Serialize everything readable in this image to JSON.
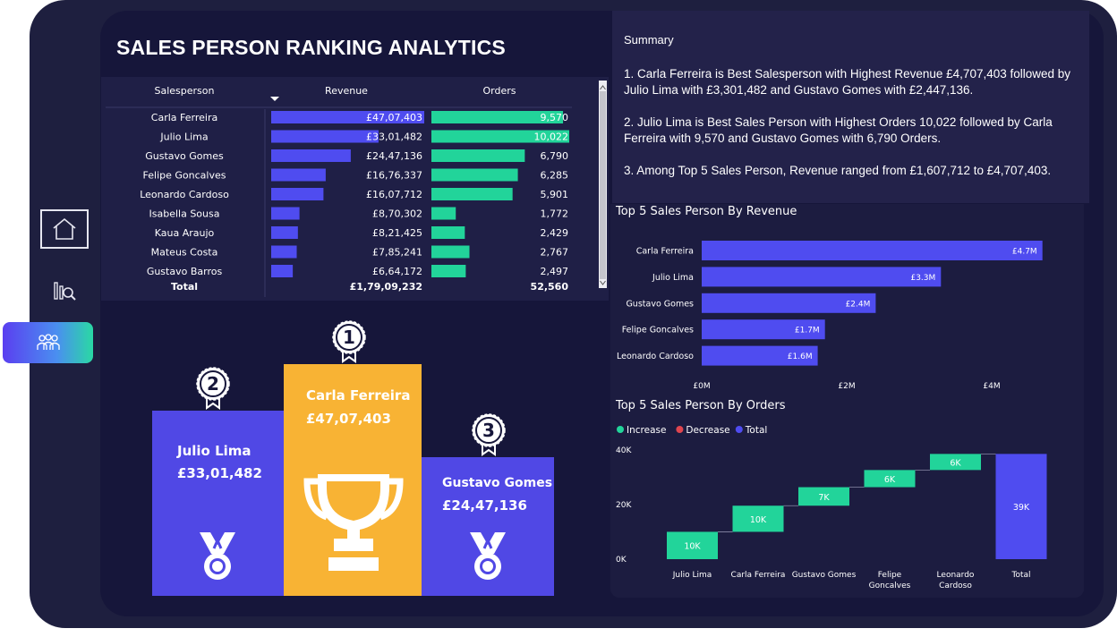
{
  "page": {
    "title": "SALES PERSON RANKING ANALYTICS"
  },
  "nav": [
    {
      "name": "home",
      "icon": "home-icon"
    },
    {
      "name": "inspect",
      "icon": "chart-search-icon"
    },
    {
      "name": "people",
      "icon": "people-icon",
      "active": true
    }
  ],
  "table": {
    "headers": [
      "Salesperson",
      "Revenue",
      "Orders"
    ],
    "sort_icon": "sort-desc-icon",
    "rows": [
      {
        "name": "Carla Ferreira",
        "revenue_label": "£47,07,403",
        "revenue": 4707403,
        "orders_label": "9,570",
        "orders": 9570
      },
      {
        "name": "Julio Lima",
        "revenue_label": "£33,01,482",
        "revenue": 3301482,
        "orders_label": "10,022",
        "orders": 10022
      },
      {
        "name": "Gustavo Gomes",
        "revenue_label": "£24,47,136",
        "revenue": 2447136,
        "orders_label": "6,790",
        "orders": 6790
      },
      {
        "name": "Felipe Goncalves",
        "revenue_label": "£16,76,337",
        "revenue": 1676337,
        "orders_label": "6,285",
        "orders": 6285
      },
      {
        "name": "Leonardo Cardoso",
        "revenue_label": "£16,07,712",
        "revenue": 1607712,
        "orders_label": "5,901",
        "orders": 5901
      },
      {
        "name": "Isabella Sousa",
        "revenue_label": "£8,70,302",
        "revenue": 870302,
        "orders_label": "1,772",
        "orders": 1772
      },
      {
        "name": "Kaua Araujo",
        "revenue_label": "£8,21,425",
        "revenue": 821425,
        "orders_label": "2,429",
        "orders": 2429
      },
      {
        "name": "Mateus Costa",
        "revenue_label": "£7,85,241",
        "revenue": 785241,
        "orders_label": "2,767",
        "orders": 2767
      },
      {
        "name": "Gustavo Barros",
        "revenue_label": "£6,64,172",
        "revenue": 664172,
        "orders_label": "2,497",
        "orders": 2497
      }
    ],
    "total": {
      "label": "Total",
      "revenue_label": "£1,79,09,232",
      "orders_label": "52,560"
    }
  },
  "podium": [
    {
      "rank": "1",
      "name": "Carla Ferreira",
      "value": "£47,07,403",
      "icon": "trophy-icon"
    },
    {
      "rank": "2",
      "name": "Julio Lima",
      "value": "£33,01,482",
      "icon": "medal-icon"
    },
    {
      "rank": "3",
      "name": "Gustavo Gomes",
      "value": "£24,47,136",
      "icon": "medal-icon"
    }
  ],
  "summary": {
    "heading": "Summary",
    "points": [
      "1. Carla Ferreira is Best Salesperson with Highest Revenue £4,707,403 followed by Julio Lima with £3,301,482 and Gustavo Gomes with £2,447,136.",
      "2. Julio Lima is Best Sales Person with Highest Orders 10,022 followed by Carla Ferreira with 9,570 and Gustavo Gomes with 6,790 Orders.",
      "3. Among Top 5 Sales Person, Revenue ranged from £1,607,712 to £4,707,403."
    ]
  },
  "colors": {
    "revenue_bar": "#4f4cf0",
    "orders_bar": "#22d49a",
    "podium_gold": "#f8b334",
    "podium_purple": "#5048e5",
    "increase": "#22d49a",
    "decrease": "#e0454f",
    "total": "#4f4cf0"
  },
  "chart_data": [
    {
      "type": "bar",
      "title": "Top 5 Sales Person By Revenue",
      "orientation": "horizontal",
      "categories": [
        "Carla Ferreira",
        "Julio Lima",
        "Gustavo Gomes",
        "Felipe Goncalves",
        "Leonardo Cardoso"
      ],
      "values": [
        4.7,
        3.3,
        2.4,
        1.7,
        1.6
      ],
      "data_labels": [
        "£4.7M",
        "£3.3M",
        "£2.4M",
        "£1.7M",
        "£1.6M"
      ],
      "x_ticks": [
        "£0M",
        "£2M",
        "£4M"
      ],
      "xlim": [
        0,
        4.9
      ]
    },
    {
      "type": "bar",
      "subtype": "waterfall",
      "title": "Top 5 Sales Person By Orders",
      "legend": [
        "Increase",
        "Decrease",
        "Total"
      ],
      "categories": [
        "Julio Lima",
        "Carla Ferreira",
        "Gustavo Gomes",
        "Felipe Goncalves",
        "Leonardo Cardoso",
        "Total"
      ],
      "values": [
        10022,
        9570,
        6790,
        6285,
        5901,
        38568
      ],
      "data_labels": [
        "10K",
        "10K",
        "7K",
        "6K",
        "6K",
        "39K"
      ],
      "y_ticks": [
        "0K",
        "20K",
        "40K"
      ],
      "ylim": [
        0,
        40000
      ]
    }
  ]
}
